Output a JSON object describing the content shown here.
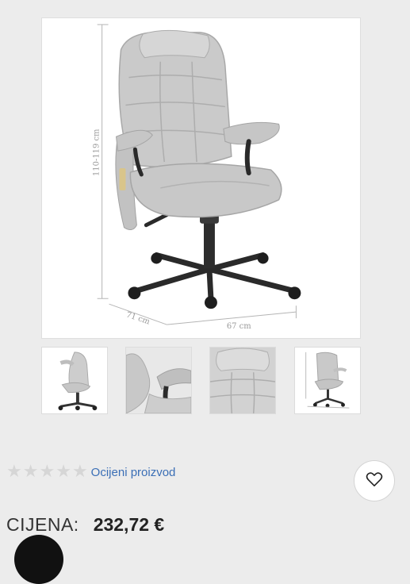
{
  "product": {
    "main_image": {
      "height_label": "110-119 cm",
      "depth_label": "71 cm",
      "width_label": "67 cm"
    },
    "thumbnails": [
      {
        "name": "thumbnail-side-view"
      },
      {
        "name": "thumbnail-armrest-detail"
      },
      {
        "name": "thumbnail-backrest-detail"
      },
      {
        "name": "thumbnail-dimensions"
      }
    ],
    "rating": {
      "stars": 5,
      "filled": 0,
      "star_glyph": "★",
      "rate_link_label": "Ocijeni proizvod"
    },
    "wishlist_icon": "heart-icon",
    "price": {
      "label": "CIJENA:",
      "value": "232,72 €"
    }
  },
  "colors": {
    "background": "#ececec",
    "link": "#3b6fb6",
    "star_empty": "#d6d6d6",
    "chair": "#c9c9c9"
  }
}
